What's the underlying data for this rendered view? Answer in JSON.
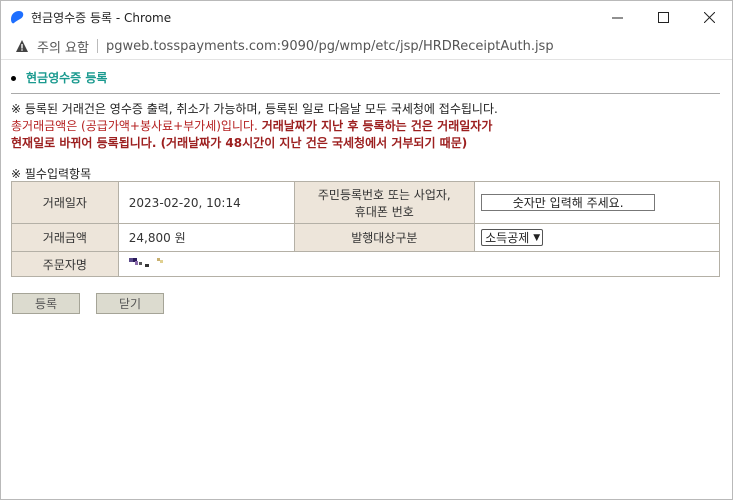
{
  "window": {
    "title": "현금영수증 등록 - Chrome",
    "warning": "주의 요함",
    "url": "pgweb.tosspayments.com:9090/pg/wmp/etc/jsp/HRDReceiptAuth.jsp"
  },
  "page": {
    "section_title": "현금영수증 등록",
    "notice_line1": "※ 등록된 거래건은 영수증 출력, 취소가 가능하며, 등록된 일로 다음날 모두 국세청에 접수됩니다.",
    "notice_line2a": "총거래금액은 (공급가액+봉사료+부가세)입니다.",
    "notice_line2b": "거래날짜가 지난 후 등록하는 건은 거래일자가",
    "notice_line3": "현재일로 바뀌어 등록됩니다. (거래날짜가 48시간이 지난 건은 국세청에서 거부되기 때문)",
    "required_label": "※ 필수입력항목"
  },
  "form": {
    "date_label": "거래일자",
    "date_value": "2023-02-20, 10:14",
    "id_label_1": "주민등록번호 또는 사업자,",
    "id_label_2": "휴대폰 번호",
    "id_placeholder": "숫자만 입력해 주세요.",
    "amount_label": "거래금액",
    "amount_value": "24,800 원",
    "type_label": "발행대상구분",
    "type_selected": "소득공제",
    "name_label": "주문자명"
  },
  "buttons": {
    "register": "등록",
    "close": "닫기"
  },
  "colors": {
    "accent_title": "#1a9a8f",
    "notice_red": "#b52020",
    "label_bg": "#ede5da"
  }
}
